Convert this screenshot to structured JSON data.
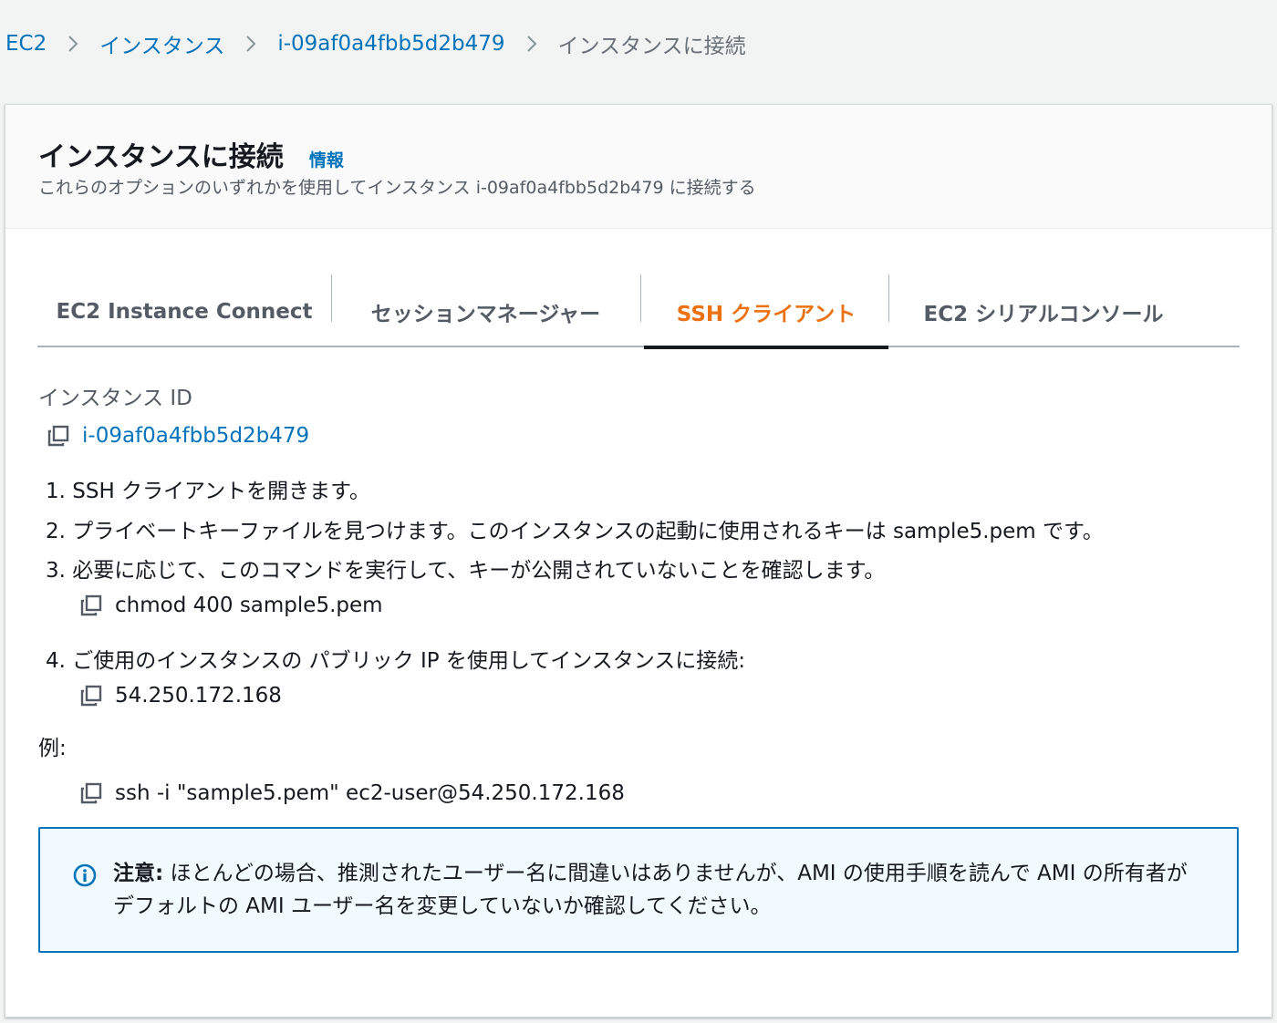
{
  "breadcrumb": {
    "items": [
      "EC2",
      "インスタンス",
      "i-09af0a4fbb5d2b479"
    ],
    "current": "インスタンスに接続"
  },
  "header": {
    "title": "インスタンスに接続",
    "info_link": "情報",
    "description": "これらのオプションのいずれかを使用してインスタンス i-09af0a4fbb5d2b479 に接続する"
  },
  "tabs": [
    {
      "label": "EC2 Instance Connect",
      "active": false
    },
    {
      "label": "セッションマネージャー",
      "active": false
    },
    {
      "label": "SSH クライアント",
      "active": true
    },
    {
      "label": "EC2 シリアルコンソール",
      "active": false
    }
  ],
  "instance": {
    "label": "インスタンス ID",
    "id": "i-09af0a4fbb5d2b479"
  },
  "steps": [
    "1. SSH クライアントを開きます。",
    "2. プライベートキーファイルを見つけます。このインスタンスの起動に使用されるキーは sample5.pem です。",
    "3. 必要に応じて、このコマンドを実行して、キーが公開されていないことを確認します。",
    "4. ご使用のインスタンスの パブリック IP を使用してインスタンスに接続:"
  ],
  "commands": {
    "chmod": "chmod 400 sample5.pem",
    "public_ip": "54.250.172.168",
    "ssh": "ssh -i \"sample5.pem\" ec2-user@54.250.172.168"
  },
  "example_label": "例:",
  "alert": {
    "strong": "注意:",
    "text": " ほとんどの場合、推測されたユーザー名に間違いはありませんが、AMI の使用手順を読んで AMI の所有者がデフォルトの AMI ユーザー名を変更していないか確認してください。"
  },
  "icons": {
    "copy": "copy-icon",
    "info": "info-circle-icon",
    "separator": "chevron-right-icon"
  },
  "colors": {
    "link": "#0073bb",
    "active_tab": "#ec7211",
    "alert_border": "#0073bb",
    "alert_bg": "#f1faff"
  }
}
